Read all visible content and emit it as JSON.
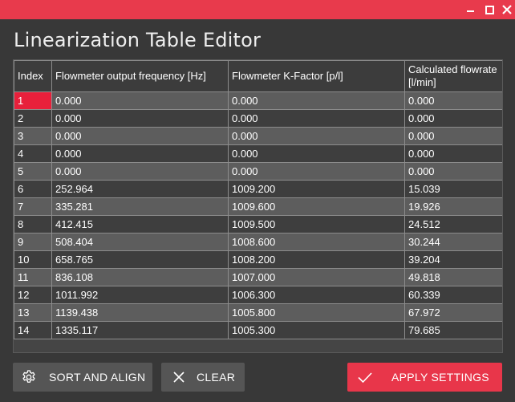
{
  "window": {
    "title": "Linearization Table Editor",
    "controls": [
      "minimize-icon",
      "maximize-icon",
      "close-icon"
    ],
    "accent_color": "#e8364a"
  },
  "table": {
    "headers": [
      "Index",
      "Flowmeter output frequency [Hz]",
      "Flowmeter K-Factor [p/l]",
      "Calculated flowrate [l/min]"
    ],
    "rows": [
      [
        "1",
        "0.000",
        "0.000",
        "0.000"
      ],
      [
        "2",
        "0.000",
        "0.000",
        "0.000"
      ],
      [
        "3",
        "0.000",
        "0.000",
        "0.000"
      ],
      [
        "4",
        "0.000",
        "0.000",
        "0.000"
      ],
      [
        "5",
        "0.000",
        "0.000",
        "0.000"
      ],
      [
        "6",
        "252.964",
        "1009.200",
        "15.039"
      ],
      [
        "7",
        "335.281",
        "1009.600",
        "19.926"
      ],
      [
        "8",
        "412.415",
        "1009.500",
        "24.512"
      ],
      [
        "9",
        "508.404",
        "1008.600",
        "30.244"
      ],
      [
        "10",
        "658.765",
        "1008.200",
        "39.204"
      ],
      [
        "11",
        "836.108",
        "1007.000",
        "49.818"
      ],
      [
        "12",
        "1011.992",
        "1006.300",
        "60.339"
      ],
      [
        "13",
        "1139.438",
        "1005.800",
        "67.972"
      ],
      [
        "14",
        "1335.117",
        "1005.300",
        "79.685"
      ]
    ],
    "selected_cell": {
      "row": 1,
      "column": "Index"
    }
  },
  "buttons": {
    "sort_label": "SORT AND ALIGN",
    "sort_icon": "gear-icon",
    "clear_label": "CLEAR",
    "clear_icon": "x-icon",
    "apply_label": "APPLY SETTINGS",
    "apply_icon": "checkmark-icon"
  }
}
